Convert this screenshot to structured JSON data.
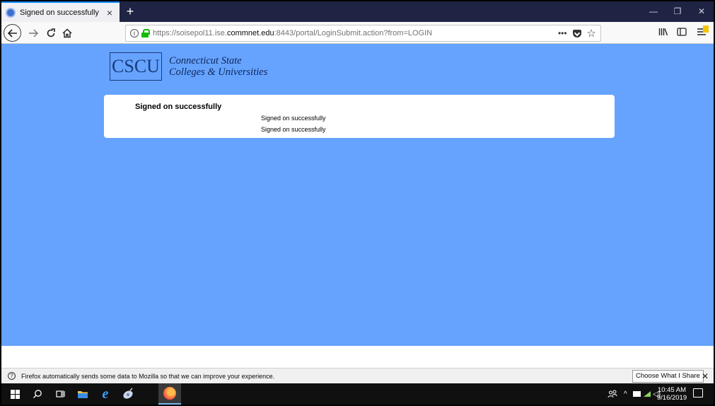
{
  "browser": {
    "tab_title": "Signed on successfully",
    "tab_close": "×",
    "new_tab": "+",
    "url_scheme_prefix": "https://soisepol11.ise.",
    "url_host": "commnet.edu",
    "url_suffix": ":8443/portal/LoginSubmit.action?from=LOGIN",
    "url_more": "•••",
    "bookmark_star": "☆",
    "window_min": "—",
    "window_restore": "❐",
    "window_close": "✕"
  },
  "page": {
    "logo_box": "CSCU",
    "logo_line1": "Connecticut State",
    "logo_line2": "Colleges & Universities",
    "heading": "Signed on successfully",
    "line1": "Signed on successfully",
    "line2": "Signed on successfully",
    "background_color": "#66a3ff"
  },
  "notification": {
    "text": "Firefox automatically sends some data to Mozilla so that we can improve your experience.",
    "button": "Choose What I Share",
    "close": "✕"
  },
  "taskbar": {
    "time": "10:45 AM",
    "date": "9/16/2019"
  }
}
